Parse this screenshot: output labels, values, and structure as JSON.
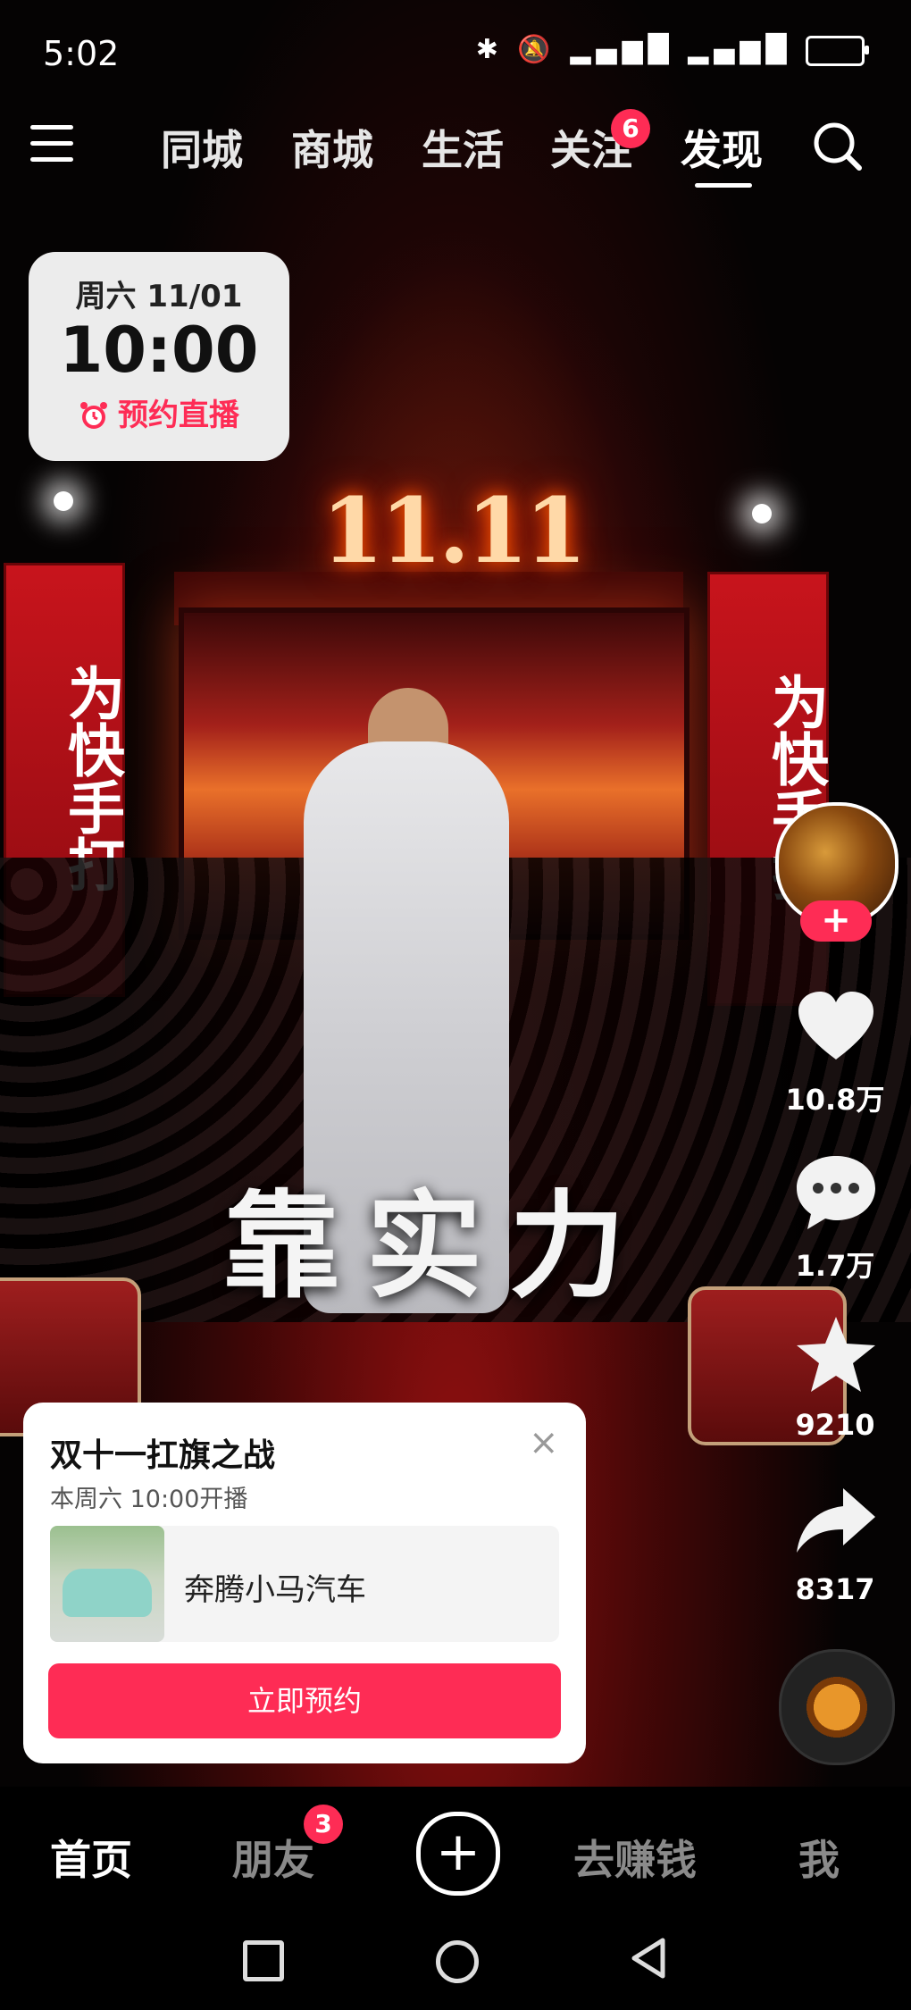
{
  "status_bar": {
    "time": "5:02"
  },
  "top_nav": {
    "tabs": [
      {
        "label": "同城"
      },
      {
        "label": "商城"
      },
      {
        "label": "生活"
      },
      {
        "label": "关注"
      },
      {
        "label": "发现"
      }
    ],
    "active_tab": "发现",
    "follow_badge": "6"
  },
  "schedule_card": {
    "date": "周六 11/01",
    "time": "10:00",
    "action": "预约直播"
  },
  "video": {
    "stage_sign": "11.11",
    "banner_text": "为快手打",
    "slogan": "靠实力"
  },
  "actions": {
    "likes": "10.8万",
    "comments": "1.7万",
    "favorites": "9210",
    "shares": "8317",
    "follow_plus": "+"
  },
  "promo": {
    "title": "双十一扛旗之战",
    "subtitle": "本周六 10:00开播",
    "close": "×",
    "product_name": "奔腾小马汽车",
    "button": "立即预约"
  },
  "bottom_nav": {
    "tabs": [
      {
        "label": "首页"
      },
      {
        "label": "朋友"
      },
      {
        "label": "去赚钱"
      },
      {
        "label": "我"
      }
    ],
    "friends_badge": "3",
    "create": "+"
  },
  "colors": {
    "accent": "#fe2c55",
    "background": "#000000"
  }
}
